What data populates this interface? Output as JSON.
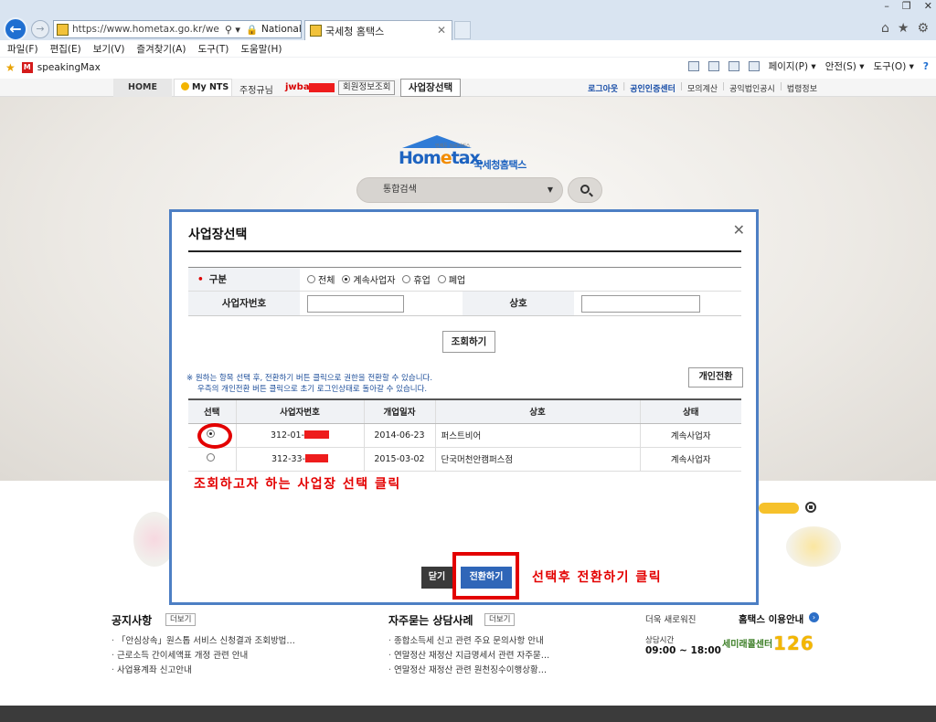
{
  "browser": {
    "url": "https://www.hometax.go.kr/we",
    "site_name": "National Ta...",
    "tab_title": "국세청 홈택스",
    "menu": [
      "파일(F)",
      "편집(E)",
      "보기(V)",
      "즐겨찾기(A)",
      "도구(T)",
      "도움말(H)"
    ],
    "favorite": "speakingMax",
    "commands": [
      "페이지(P) ▾",
      "안전(S) ▾",
      "도구(O) ▾"
    ]
  },
  "topnav": {
    "home": "HOME",
    "mynts": "My NTS",
    "user_prefix": "주정규님",
    "user_id": "jwbae",
    "member_info": "회원정보조회",
    "biz_select": "사업장선택",
    "right_links": [
      "로그아웃",
      "공인인증센터",
      "모의계산",
      "공익법인공시",
      "법령정보"
    ]
  },
  "hero": {
    "logo_text": "Hometax",
    "logo_kr": "국세청홈택스",
    "logo_sub": "언제든 실세서비스",
    "search_label": "통합검색"
  },
  "modal": {
    "title": "사업장선택",
    "form": {
      "type_label": "구분",
      "type_options": [
        "전체",
        "계속사업자",
        "휴업",
        "폐업"
      ],
      "type_selected": 1,
      "bizno_label": "사업자번호",
      "name_label": "상호"
    },
    "inquiry_button": "조회하기",
    "notice_line1": "※ 원하는 항목 선택 후, 전환하기 버튼 클릭으로 권한을 전환할 수 있습니다.",
    "notice_line2": "우측의 개인전환 버튼 클릭으로 초기 로그인상태로 돌아갈 수 있습니다.",
    "personal_switch": "개인전환",
    "columns": [
      "선택",
      "사업자번호",
      "개업일자",
      "상호",
      "상태"
    ],
    "rows": [
      {
        "bizno": "312-01-",
        "open_date": "2014-06-23",
        "name": "퍼스트비어",
        "status": "계속사업자",
        "selected": true
      },
      {
        "bizno": "312-33-",
        "open_date": "2015-03-02",
        "name": "단국머천안캠퍼스점",
        "status": "계속사업자",
        "selected": false
      }
    ],
    "close_button": "닫기",
    "switch_button": "전환하기",
    "annotation_select": "조회하고자 하는 사업장 선택 클릭",
    "annotation_switch": "선택후 전환하기 클릭"
  },
  "info": {
    "notice_title": "공지사항",
    "more": "더보기",
    "notices": [
      "「안심상속」원스톱 서비스 신청결과 조회방법…",
      "근로소득 간이세액표 개정 관련 안내",
      "사업용계좌 신고안내"
    ],
    "faq_title": "자주묻는 상담사례",
    "faqs": [
      "종합소득세 신고 관련 주요 문의사항 안내",
      "연말정산 재정산 지급명세서 관련 자주묻…",
      "연말정산 재정산 관련 원천징수이행상황…"
    ],
    "new_label": "더욱 새로워진",
    "guide_label": "홈택스 이용안내",
    "consult_label": "상담시간",
    "consult_hours": "09:00 ~ 18:00",
    "callcenter": "세미래콜센터",
    "call_number": "126"
  },
  "colors": {
    "accent": "#2f66b8",
    "annotation": "#e30000",
    "modal_border": "#4d7fc4"
  }
}
